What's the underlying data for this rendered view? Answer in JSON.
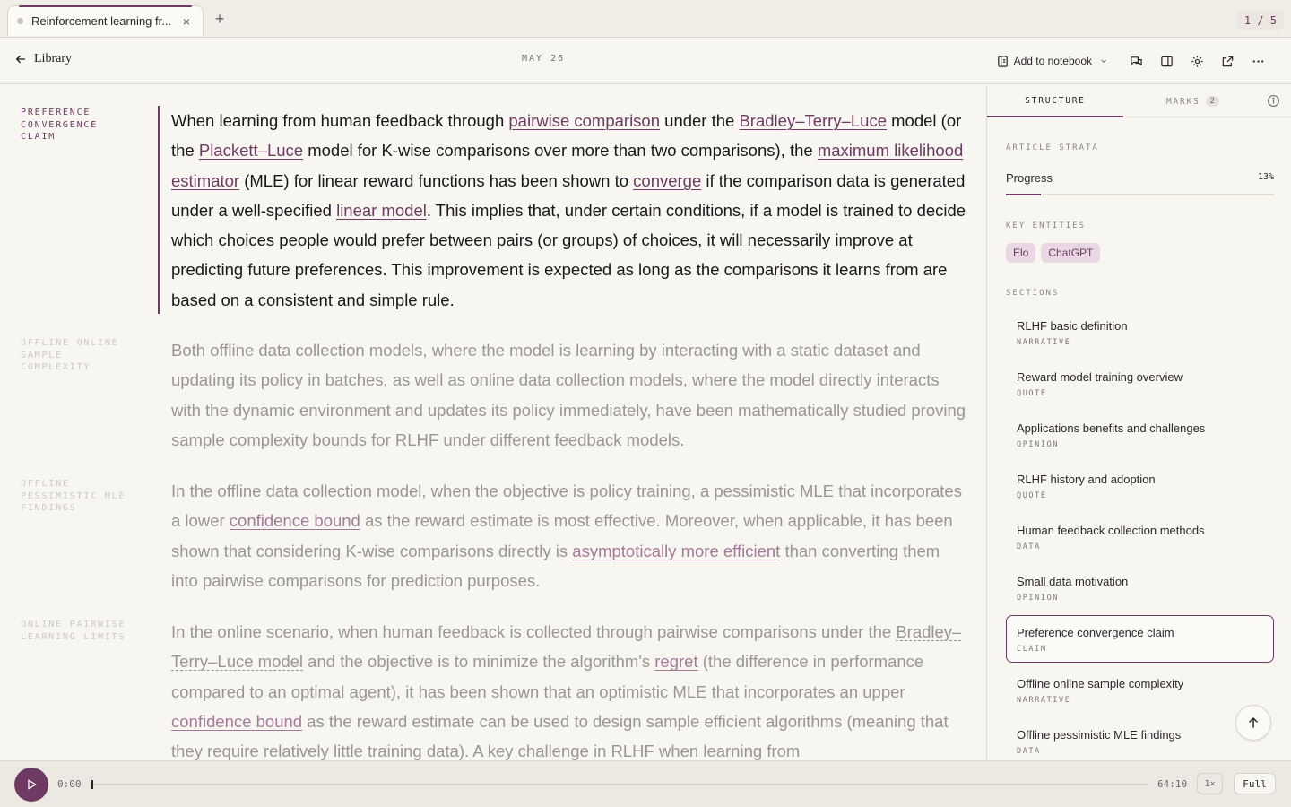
{
  "tabbar": {
    "tab_title": "Reinforcement learning fr...",
    "close_glyph": "×",
    "new_glyph": "+",
    "page_counter": "1 / 5"
  },
  "header": {
    "back_label": "Library",
    "date": "MAY 26",
    "add_to_notebook": "Add to notebook"
  },
  "article": {
    "p1": {
      "label": "PREFERENCE CONVERGENCE CLAIM",
      "t1": "When learning from human feedback through ",
      "l1": "pairwise comparison",
      "t2": " under the ",
      "l2": "Bradley–Terry–Luce",
      "t3": " model (or the ",
      "l3": "Plackett–Luce",
      "t4": " model for K-wise comparisons over more than two comparisons), the ",
      "l4": "maximum likelihood estimator",
      "t5": " (MLE) for linear reward functions has been shown to ",
      "l5": "converge",
      "t6": " if the comparison data is generated under a well-specified ",
      "l6": "linear model",
      "t7": ". This implies that, under certain conditions, if a model is trained to decide which choices people would prefer between pairs (or groups) of choices, it will necessarily improve at predicting future preferences. This improvement is expected as long as the comparisons it learns from are based on a consistent and simple rule."
    },
    "p2": {
      "label": "OFFLINE ONLINE SAMPLE COMPLEXITY",
      "text": "Both offline data collection models, where the model is learning by interacting with a static dataset and updating its policy in batches, as well as online data collection models, where the model directly interacts with the dynamic environment and updates its policy immediately, have been mathematically studied proving sample complexity bounds for RLHF under different feedback models."
    },
    "p3": {
      "label": "OFFLINE PESSIMISTIC MLE FINDINGS",
      "t1": "In the offline data collection model, when the objective is policy training, a pessimistic MLE that incorporates a lower ",
      "l1": "confidence bound",
      "t2": " as the reward estimate is most effective. Moreover, when applicable, it has been shown that considering K-wise comparisons directly is ",
      "l2": "asymptotically more efficient",
      "t3": " than converting them into pairwise comparisons for prediction purposes."
    },
    "p4": {
      "label": "ONLINE PAIRWISE LEARNING LIMITS",
      "t1": "In the online scenario, when human feedback is collected through pairwise comparisons under the ",
      "l1": "Bradley–Terry–Luce model",
      "t2": " and the objective is to minimize the algorithm's ",
      "l2": "regret",
      "t3": " (the difference in performance compared to an optimal agent), it has been shown that an optimistic MLE that incorporates an upper ",
      "l3": "confidence bound",
      "t4": " as the reward estimate can be used to design sample efficient algorithms (meaning that they require relatively little training data). A key challenge in RLHF when learning from"
    }
  },
  "sidebar": {
    "tab_structure": "STRUCTURE",
    "tab_marks": "MARKS",
    "marks_count": "2",
    "strata_heading": "ARTICLE STRATA",
    "progress_label": "Progress",
    "progress_value": "13%",
    "progress_fraction": 0.13,
    "entities_heading": "KEY ENTITIES",
    "entities": [
      "Elo",
      "ChatGPT"
    ],
    "sections_heading": "SECTIONS",
    "sections": [
      {
        "title": "RLHF basic definition",
        "type": "NARRATIVE"
      },
      {
        "title": "Reward model training overview",
        "type": "QUOTE"
      },
      {
        "title": "Applications benefits and challenges",
        "type": "OPINION"
      },
      {
        "title": "RLHF history and adoption",
        "type": "QUOTE"
      },
      {
        "title": "Human feedback collection methods",
        "type": "DATA"
      },
      {
        "title": "Small data motivation",
        "type": "OPINION"
      },
      {
        "title": "Preference convergence claim",
        "type": "CLAIM"
      },
      {
        "title": "Offline online sample complexity",
        "type": "NARRATIVE"
      },
      {
        "title": "Offline pessimistic MLE findings",
        "type": "DATA"
      }
    ],
    "selected_index": 6
  },
  "player": {
    "current_time": "0:00",
    "duration": "64:10",
    "speed": "1×",
    "full_label": "Full",
    "progress_fraction": 0.0
  },
  "colors": {
    "accent": "#6e3a63",
    "background": "#f8f6f1",
    "chip_bg": "#ead7e4"
  }
}
